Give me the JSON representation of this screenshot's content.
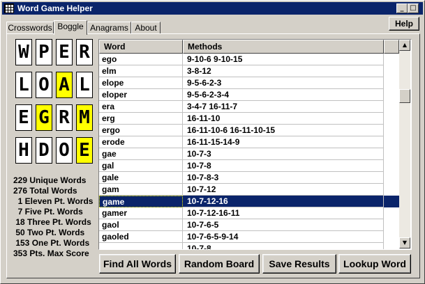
{
  "window": {
    "title": "Word Game Helper"
  },
  "titlebar_buttons": {
    "minimize": "_",
    "maximize": "□",
    "close": "✕"
  },
  "tabs": [
    "Crosswords",
    "Boggle",
    "Anagrams",
    "About"
  ],
  "active_tab": "Boggle",
  "help_label": "Help",
  "board": [
    [
      {
        "l": "W",
        "hl": false
      },
      {
        "l": "P",
        "hl": false
      },
      {
        "l": "E",
        "hl": false
      },
      {
        "l": "R",
        "hl": false
      }
    ],
    [
      {
        "l": "L",
        "hl": false
      },
      {
        "l": "O",
        "hl": false
      },
      {
        "l": "A",
        "hl": true
      },
      {
        "l": "L",
        "hl": false
      }
    ],
    [
      {
        "l": "E",
        "hl": false
      },
      {
        "l": "G",
        "hl": true
      },
      {
        "l": "R",
        "hl": false
      },
      {
        "l": "M",
        "hl": true
      }
    ],
    [
      {
        "l": "H",
        "hl": false
      },
      {
        "l": "D",
        "hl": false
      },
      {
        "l": "O",
        "hl": false
      },
      {
        "l": "E",
        "hl": true
      }
    ]
  ],
  "stats": [
    "229 Unique Words",
    "276 Total Words",
    "  1 Eleven Pt. Words",
    "  7 Five Pt. Words",
    " 18 Three Pt. Words",
    " 50 Two Pt. Words",
    " 153 One Pt. Words",
    "353 Pts. Max Score"
  ],
  "table": {
    "columns": [
      "Word",
      "Methods"
    ],
    "rows": [
      {
        "word": "ego",
        "methods": "9-10-6 9-10-15"
      },
      {
        "word": "elm",
        "methods": "3-8-12"
      },
      {
        "word": "elope",
        "methods": "9-5-6-2-3"
      },
      {
        "word": "eloper",
        "methods": "9-5-6-2-3-4"
      },
      {
        "word": "era",
        "methods": "3-4-7 16-11-7"
      },
      {
        "word": "erg",
        "methods": "16-11-10"
      },
      {
        "word": "ergo",
        "methods": "16-11-10-6 16-11-10-15"
      },
      {
        "word": "erode",
        "methods": "16-11-15-14-9"
      },
      {
        "word": "gae",
        "methods": "10-7-3"
      },
      {
        "word": "gal",
        "methods": "10-7-8"
      },
      {
        "word": "gale",
        "methods": "10-7-8-3"
      },
      {
        "word": "gam",
        "methods": "10-7-12"
      },
      {
        "word": "game",
        "methods": "10-7-12-16"
      },
      {
        "word": "gamer",
        "methods": "10-7-12-16-11"
      },
      {
        "word": "gaol",
        "methods": "10-7-6-5"
      },
      {
        "word": "gaoled",
        "methods": "10-7-6-5-9-14"
      },
      {
        "word": "",
        "methods": "10-7-8"
      }
    ],
    "selected_word": "game"
  },
  "scroll": {
    "up": "▲",
    "down": "▼",
    "position": 0.22
  },
  "buttons": {
    "find_all": "Find All Words",
    "random_board": "Random Board",
    "save_results": "Save Results",
    "lookup_word": "Lookup Word"
  },
  "colors": {
    "titlebar": "#0a246a",
    "highlight_tile": "#ffff00",
    "selection": "#0a246a",
    "face": "#d4d0c8"
  }
}
